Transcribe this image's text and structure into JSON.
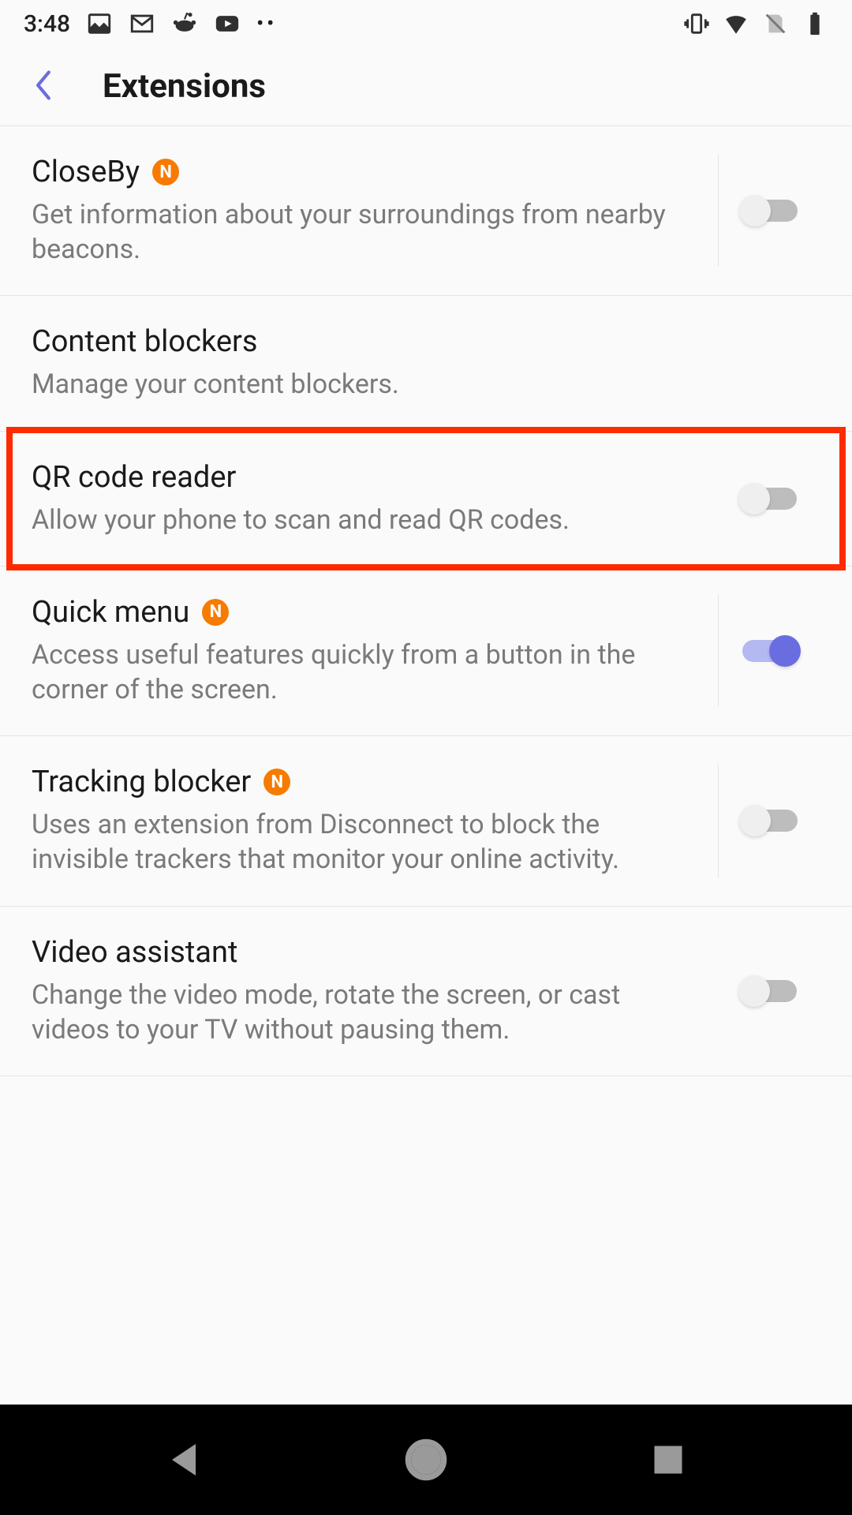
{
  "statusbar": {
    "time": "3:48"
  },
  "header": {
    "title": "Extensions"
  },
  "items": {
    "closeby": {
      "title": "CloseBy",
      "badge": "N",
      "desc": "Get information about your surroundings from nearby beacons."
    },
    "content_blockers": {
      "title": "Content blockers",
      "desc": "Manage your content blockers."
    },
    "qr": {
      "title": "QR code reader",
      "desc": "Allow your phone to scan and read QR codes."
    },
    "quick_menu": {
      "title": "Quick menu",
      "badge": "N",
      "desc": "Access useful features quickly from a button in the corner of the screen."
    },
    "tracking": {
      "title": "Tracking blocker",
      "badge": "N",
      "desc": "Uses an extension from Disconnect to block the invisible trackers that monitor your online activity."
    },
    "video": {
      "title": "Video assistant",
      "desc": "Change the video mode, rotate the screen, or cast videos to your TV without pausing them."
    }
  }
}
